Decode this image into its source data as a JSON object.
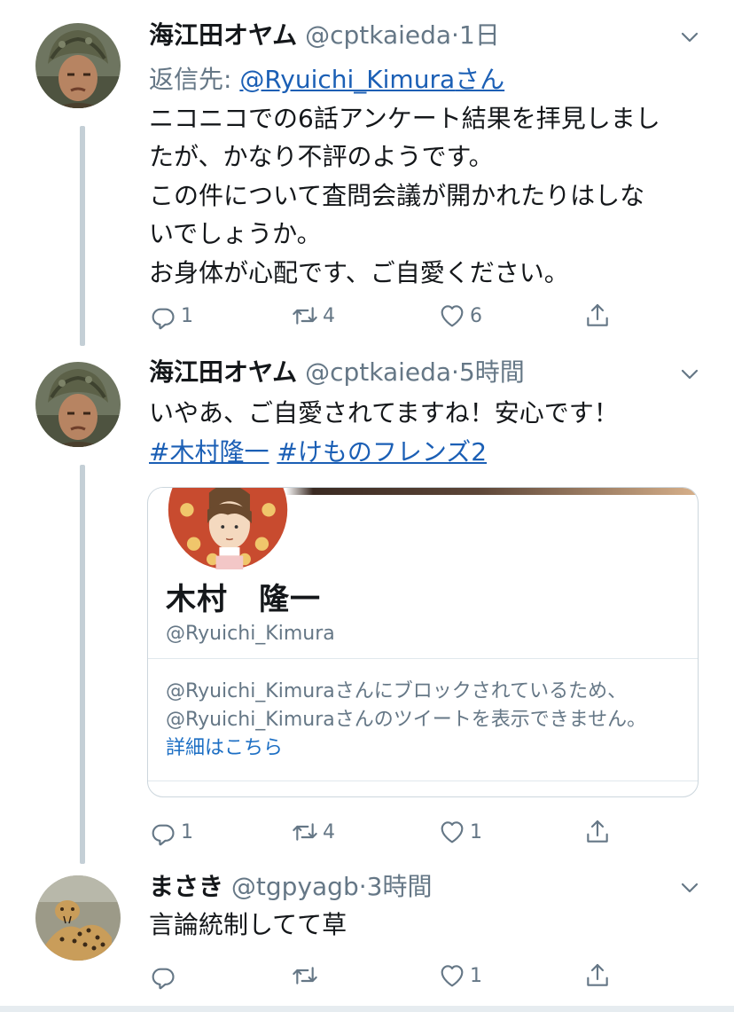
{
  "tweets": [
    {
      "name": "海江田オヤム",
      "handle": "@cptkaieda",
      "time": "1日",
      "reply_prefix": "返信先: ",
      "reply_to": "@Ryuichi_Kimura",
      "reply_suffix": "さん",
      "lines": [
        "ニコニコでの6話アンケート結果を拝見しまし",
        "たが、かなり不評のようです。",
        "この件について査問会議が開かれたりはしな",
        "いでしょうか。",
        "お身体が心配です、ご自愛ください。"
      ],
      "replies": "1",
      "retweets": "4",
      "likes": "6"
    },
    {
      "name": "海江田オヤム",
      "handle": "@cptkaieda",
      "time": "5時間",
      "lines": [
        "いやあ、ご自愛されてますね！安心です！"
      ],
      "hashtags": [
        "#木村隆一",
        "#けものフレンズ2"
      ],
      "replies": "1",
      "retweets": "4",
      "likes": "1",
      "card": {
        "name": "木村　隆一",
        "handle": "@Ryuichi_Kimura",
        "message_line1": "@Ryuichi_Kimuraさんにブロックされているため、",
        "message_line2": "@Ryuichi_Kimuraさんのツイートを表示できません。",
        "more_link": "詳細はこちら"
      }
    },
    {
      "name": "まさき",
      "handle": "@tgpyagb",
      "time": "3時間",
      "lines": [
        "言論統制してて草"
      ],
      "replies": "",
      "retweets": "",
      "likes": "1"
    }
  ],
  "colors": {
    "text": "#14171a",
    "secondary": "#657786",
    "link": "#1b5fb5",
    "thread_line": "#c4cfd6"
  },
  "icons": [
    "reply-icon",
    "retweet-icon",
    "like-icon",
    "share-icon",
    "chevron-down-icon"
  ],
  "separator": "·"
}
